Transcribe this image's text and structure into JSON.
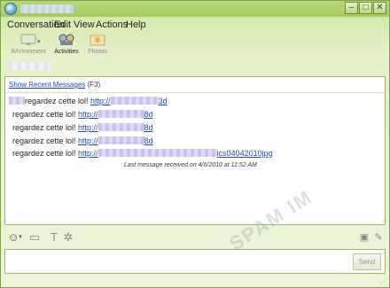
{
  "menu": [
    "Conversation",
    "Edit",
    "View",
    "Actions",
    "Help"
  ],
  "toolbar": {
    "items": [
      {
        "label": "IMVironment",
        "icon": "imvironment-icon"
      },
      {
        "label": "Activities",
        "icon": "activities-icon"
      },
      {
        "label": "Photos",
        "icon": "photos-icon"
      }
    ]
  },
  "recent": {
    "link": "Show Recent Messages",
    "shortcut": "(F3)"
  },
  "messages": [
    {
      "text": "regardez cette lol! ",
      "link_prefix": "http://",
      "link_suffix": "3d"
    },
    {
      "text": "regardez cette lol! ",
      "link_prefix": "http://",
      "link_suffix": "8d"
    },
    {
      "text": "regardez cette lol! ",
      "link_prefix": "http://",
      "link_suffix": "8d"
    },
    {
      "text": "regardez cette lol! ",
      "link_prefix": "http://",
      "link_suffix": "8d"
    },
    {
      "text": "regardez cette lol! ",
      "link_prefix": "http://",
      "link_suffix": "ics04042010jpg"
    }
  ],
  "last_message": "Last message received on 4/6/2010 at 11:52 AM",
  "watermark": "SPAM IM",
  "send_label": "Send"
}
